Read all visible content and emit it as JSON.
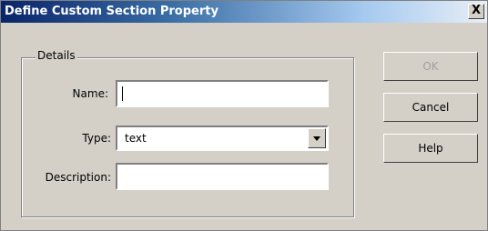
{
  "window": {
    "title": "Define Custom Section Property",
    "close_symbol": "X"
  },
  "details": {
    "group_label": "Details",
    "name_label": "Name:",
    "name_value": "",
    "type_label": "Type:",
    "type_value": "text",
    "description_label": "Description:",
    "description_value": ""
  },
  "buttons": {
    "ok": "OK",
    "cancel": "Cancel",
    "help": "Help"
  }
}
